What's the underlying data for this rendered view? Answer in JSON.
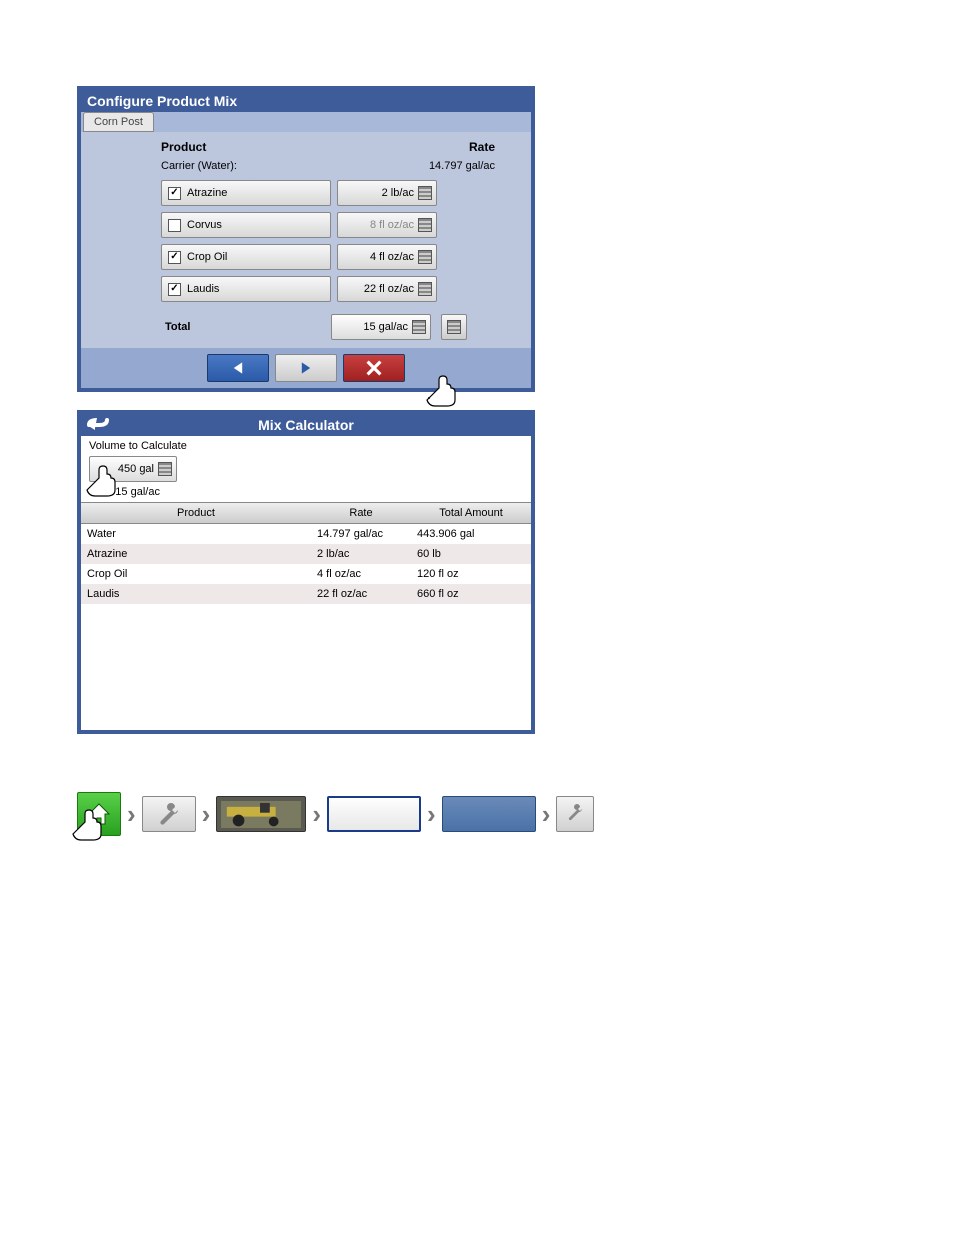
{
  "panel1": {
    "title": "Configure Product Mix",
    "tab": "Corn Post",
    "headers": {
      "product": "Product",
      "rate": "Rate"
    },
    "carrier": {
      "label": "Carrier (Water):",
      "rate": "14.797 gal/ac"
    },
    "products": [
      {
        "name": "Atrazine",
        "checked": true,
        "rate": "2 lb/ac"
      },
      {
        "name": "Corvus",
        "checked": false,
        "rate": "8 fl oz/ac"
      },
      {
        "name": "Crop Oil",
        "checked": true,
        "rate": "4 fl oz/ac"
      },
      {
        "name": "Laudis",
        "checked": true,
        "rate": "22 fl oz/ac"
      }
    ],
    "total": {
      "label": "Total",
      "value": "15 gal/ac"
    }
  },
  "panel2": {
    "title": "Mix Calculator",
    "volume_label": "Volume to Calculate",
    "volume_value": "450 gal",
    "mix_label": "Mix",
    "mix_value": "15 gal/ac",
    "headers": {
      "product": "Product",
      "rate": "Rate",
      "amount": "Total Amount"
    },
    "rows": [
      {
        "product": "Water",
        "rate": "14.797 gal/ac",
        "amount": "443.906 gal"
      },
      {
        "product": "Atrazine",
        "rate": "2 lb/ac",
        "amount": "60 lb"
      },
      {
        "product": "Crop Oil",
        "rate": "4 fl oz/ac",
        "amount": "120 fl oz"
      },
      {
        "product": "Laudis",
        "rate": "22 fl oz/ac",
        "amount": "660 fl oz"
      }
    ]
  },
  "footer": {
    "prev": "prev",
    "next": "next",
    "cancel": "cancel"
  },
  "icons": {
    "back": "back-arrow",
    "calc": "calculator",
    "home": "home",
    "wrench": "wrench",
    "tractor": "tractor"
  }
}
